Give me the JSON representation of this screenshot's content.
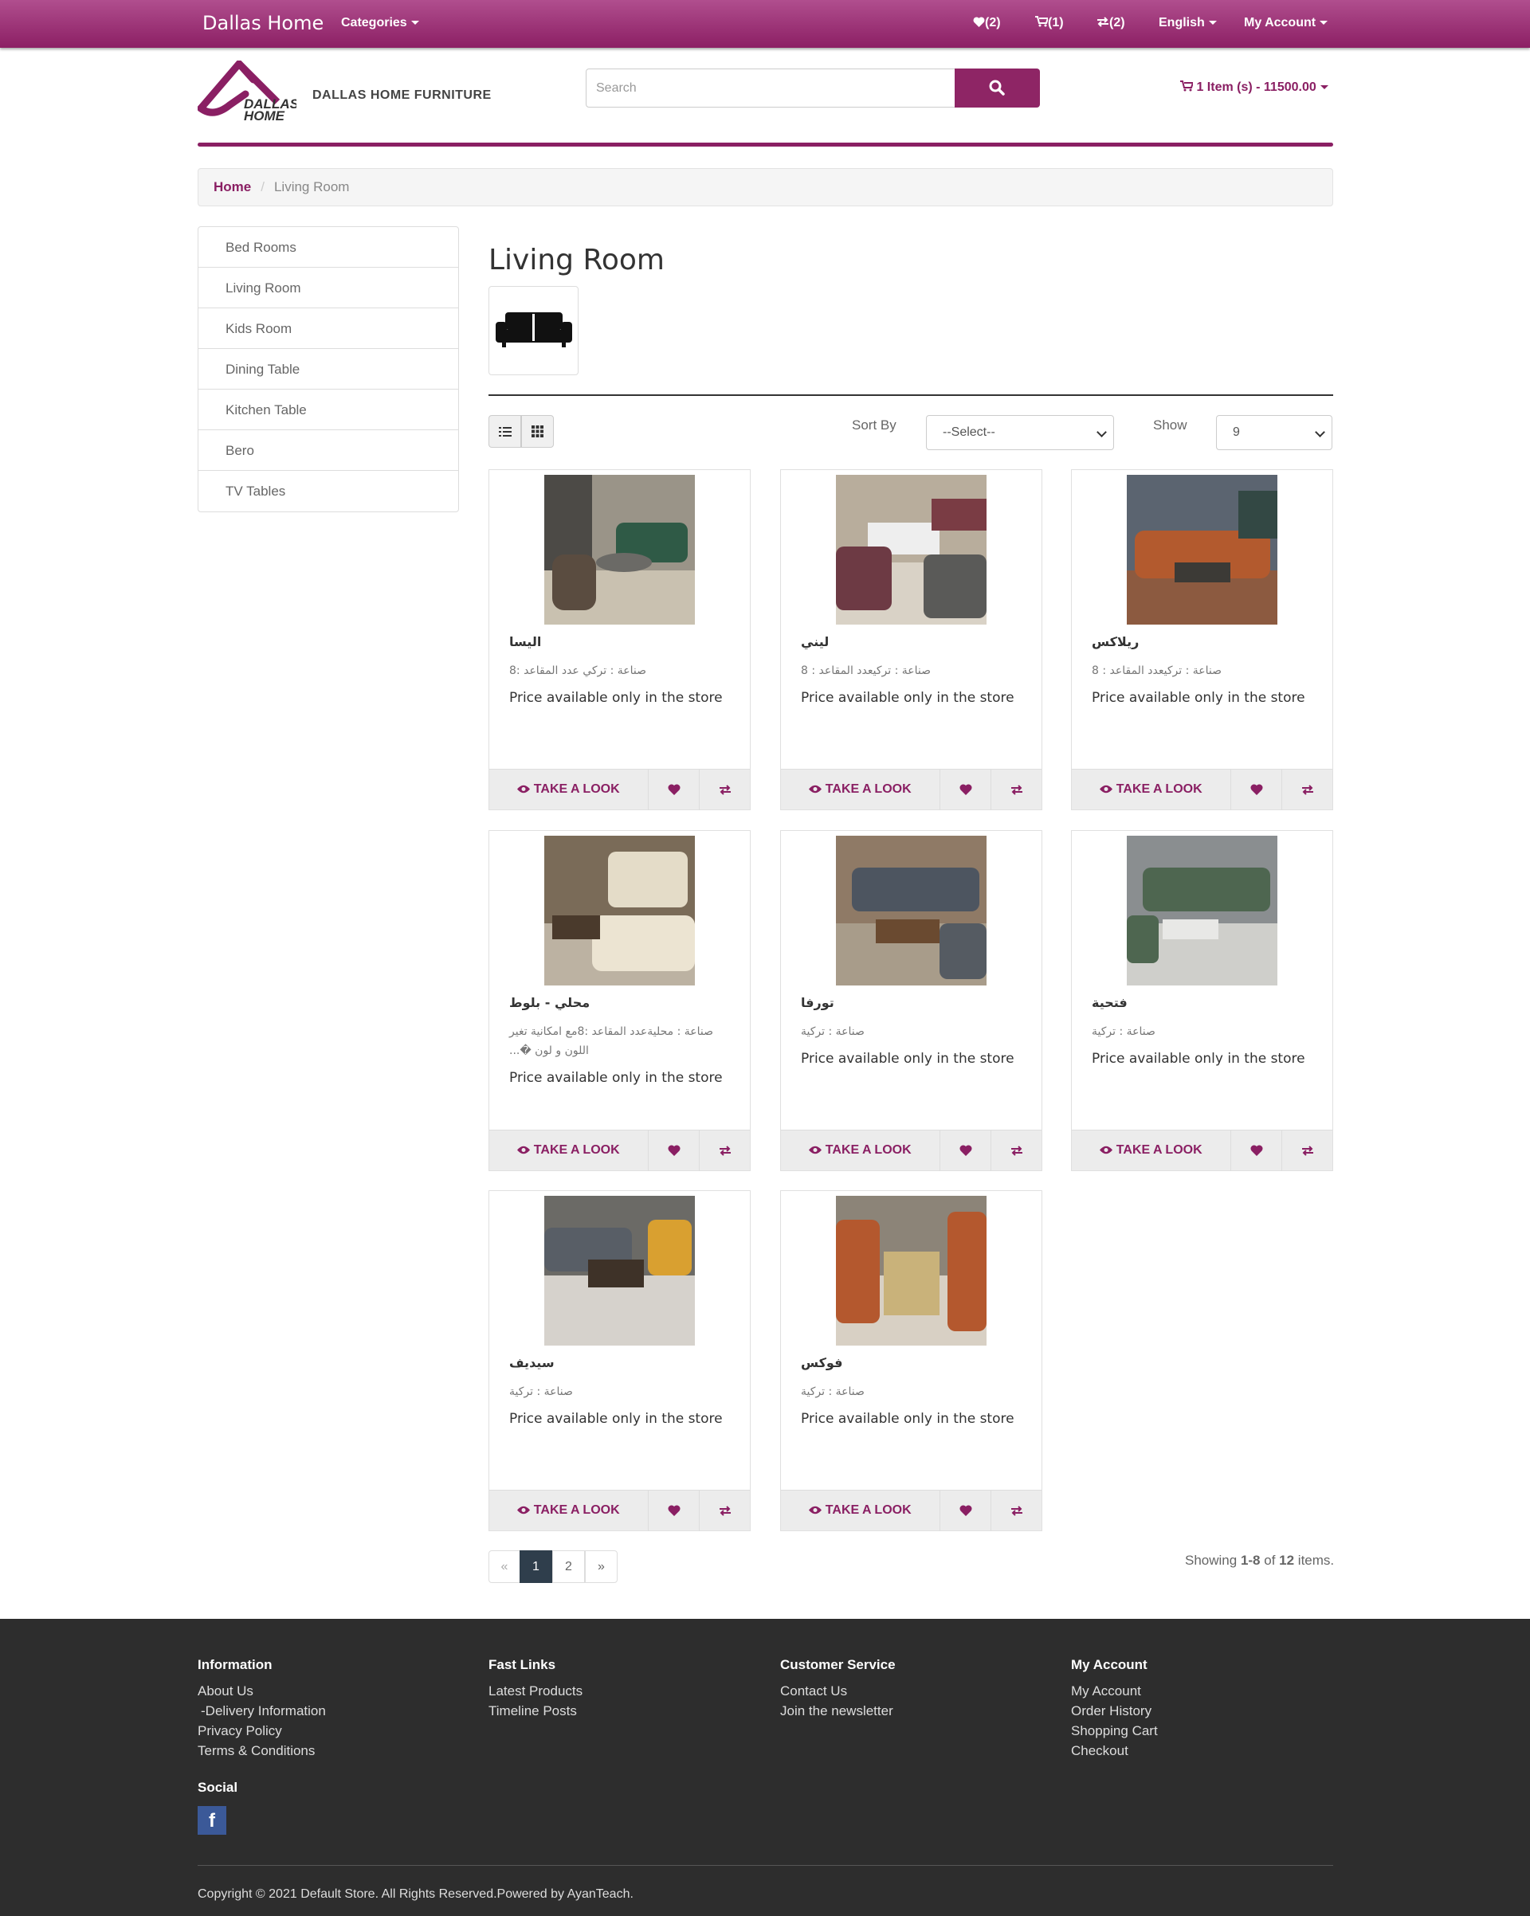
{
  "topbar": {
    "brand": "Dallas Home",
    "categories": "Categories",
    "wishlist": "(2)",
    "cart": "(1)",
    "compare": "(2)",
    "language": "English",
    "account": "My Account"
  },
  "header": {
    "logo_text_1": "DALLAS",
    "logo_text_2": "HOME",
    "store_name": "DALLAS HOME FURNITURE",
    "search_placeholder": "Search",
    "cart_summary": "1 Item (s) - 11500.00"
  },
  "breadcrumb": {
    "home": "Home",
    "current": "Living Room"
  },
  "sidebar": {
    "items": [
      "Bed Rooms",
      "Living Room",
      "Kids Room",
      "Dining Table",
      "Kitchen Table",
      "Bero",
      "TV Tables"
    ]
  },
  "main": {
    "title": "Living Room",
    "sort_label": "Sort By",
    "sort_value": "--Select--",
    "show_label": "Show",
    "show_value": "9"
  },
  "products": [
    {
      "name": "اليسا",
      "desc": "صناعة : تركي عدد المقاعد :8",
      "price": "Price available only in the store",
      "action": "TAKE A LOOK"
    },
    {
      "name": "ليني",
      "desc": "صناعة : تركيعدد المقاعد : 8",
      "price": "Price available only in the store",
      "action": "TAKE A LOOK"
    },
    {
      "name": "ريلاكس",
      "desc": "صناعة : تركيعدد المقاعد : 8",
      "price": "Price available only in the store",
      "action": "TAKE A LOOK"
    },
    {
      "name": "محلي - بلوط",
      "desc": "صناعة : محليةعدد المقاعد :8مع امكانية تغير اللون و لون �...",
      "price": "Price available only in the store",
      "action": "TAKE A LOOK"
    },
    {
      "name": "تورفا",
      "desc": "صناعة : تركية",
      "price": "Price available only in the store",
      "action": "TAKE A LOOK"
    },
    {
      "name": "فتحية",
      "desc": "صناعة : تركية",
      "price": "Price available only in the store",
      "action": "TAKE A LOOK"
    },
    {
      "name": "سيديف",
      "desc": "صناعة : تركية",
      "price": "Price available only in the store",
      "action": "TAKE A LOOK"
    },
    {
      "name": "فوكس",
      "desc": "صناعة : تركية",
      "price": "Price available only in the store",
      "action": "TAKE A LOOK"
    }
  ],
  "pagination": {
    "prev": "«",
    "p1": "1",
    "p2": "2",
    "next": "»"
  },
  "showing": {
    "prefix": "Showing ",
    "range": "1-8",
    "mid": " of ",
    "total": "12",
    "suffix": " items."
  },
  "footer": {
    "information": {
      "title": "Information",
      "links": [
        "About Us",
        "-Delivery Information",
        "Privacy Policy",
        "Terms & Conditions"
      ]
    },
    "fast_links": {
      "title": "Fast Links",
      "links": [
        "Latest Products",
        "Timeline Posts"
      ]
    },
    "customer_service": {
      "title": "Customer Service",
      "links": [
        "Contact Us",
        "Join the newsletter"
      ]
    },
    "my_account": {
      "title": "My Account",
      "links": [
        "My Account",
        "Order History",
        "Shopping Cart",
        "Checkout"
      ]
    },
    "social_title": "Social",
    "facebook": "f",
    "copyright": "Copyright © 2021 Default Store. All Rights Reserved.Powered by AyanTeach."
  },
  "colors": {
    "brand": "#8a1f63",
    "footer": "#2d2d2d",
    "pager_active": "#2f3e4c"
  }
}
